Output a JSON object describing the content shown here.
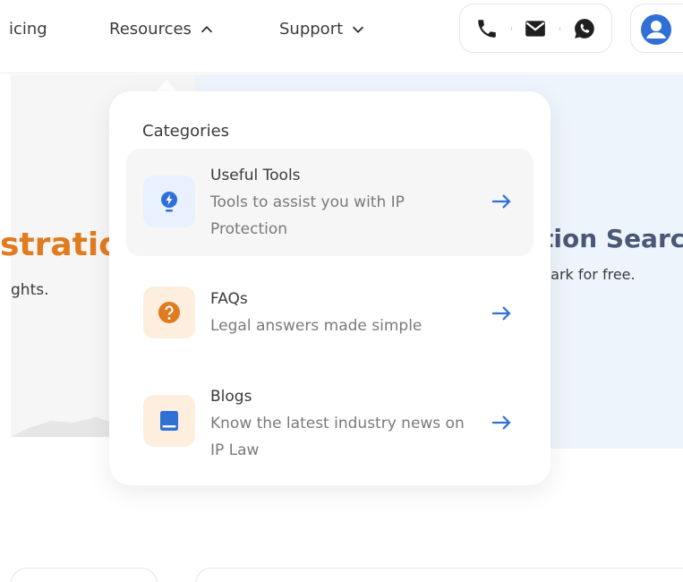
{
  "nav": {
    "links": [
      {
        "label": "icing"
      },
      {
        "label": "Resources"
      },
      {
        "label": "Support"
      }
    ],
    "contact_icons": [
      "phone-icon",
      "mail-icon",
      "whatsapp-icon"
    ],
    "account_icon": "user-avatar-icon"
  },
  "hero": {
    "left_heading": "stratio",
    "left_sub": "ghts.",
    "right_heading": "tion Searc",
    "right_sub": "nark for free."
  },
  "dropdown": {
    "category_title": "Categories",
    "items": [
      {
        "title": "Useful Tools",
        "desc": "Tools to assist you with IP Protection",
        "icon": "lightbulb-bolt-icon"
      },
      {
        "title": "FAQs",
        "desc": "Legal answers made simple",
        "icon": "question-icon"
      },
      {
        "title": "Blogs",
        "desc": "Know the latest industry news on IP Law",
        "icon": "book-icon"
      }
    ]
  },
  "colors": {
    "brand_blue": "#2f6fd6",
    "accent_orange": "#e07b1f",
    "tools_icon_bg": "#e8f1fd",
    "faq_icon_bg": "#fdeede",
    "blog_icon_bg": "#fdeede"
  }
}
